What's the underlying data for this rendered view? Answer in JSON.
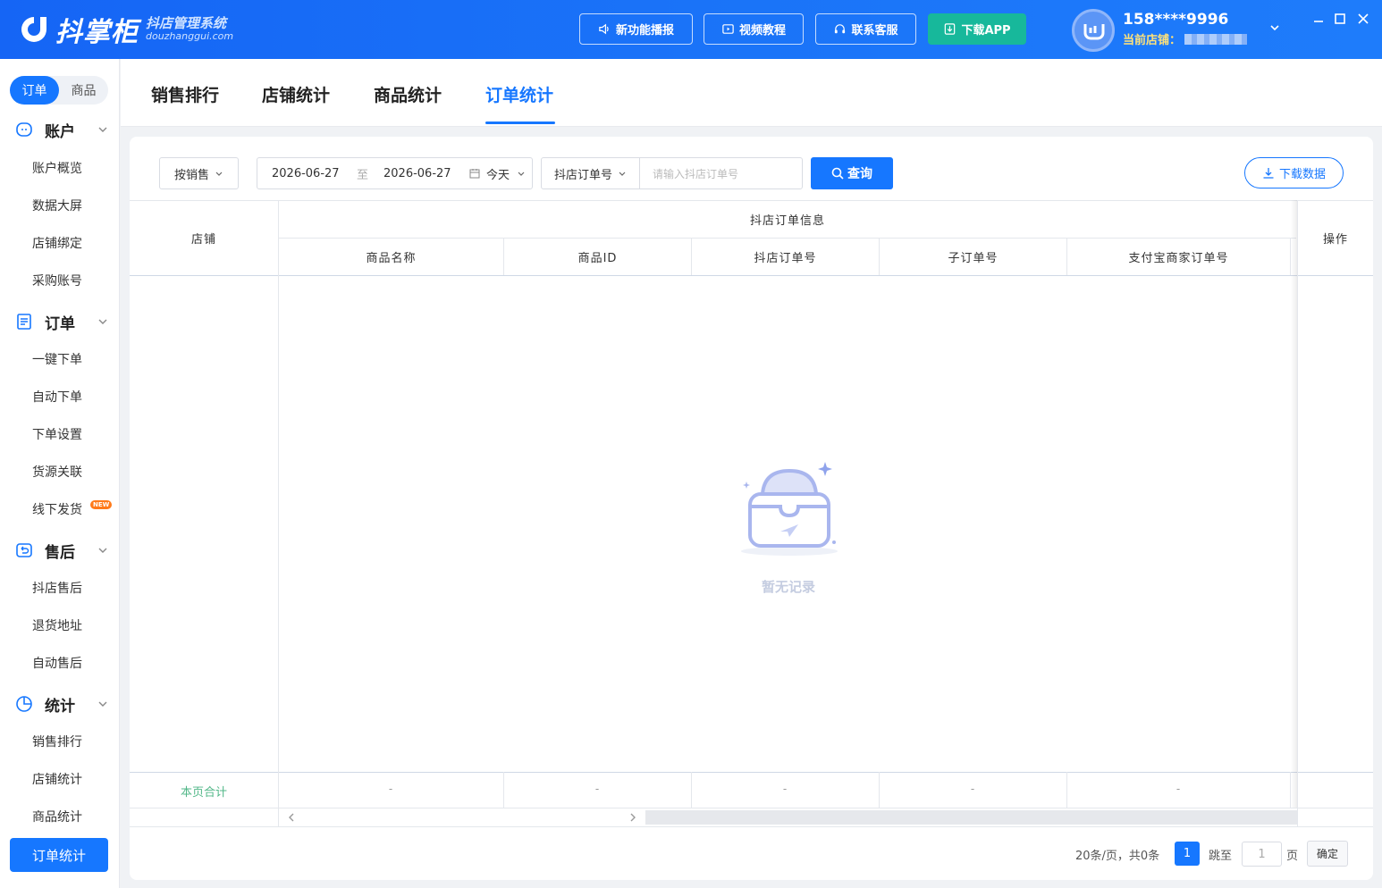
{
  "header": {
    "logo_name": "抖掌柜",
    "logo_tagline": "抖店管理系统",
    "logo_domain": "douzhanggui.com",
    "buttons": [
      {
        "label": "新功能播报",
        "icon": "speaker-icon"
      },
      {
        "label": "视频教程",
        "icon": "video-icon"
      },
      {
        "label": "联系客服",
        "icon": "headset-icon"
      },
      {
        "label": "下载APP",
        "icon": "download-icon"
      }
    ],
    "user_phone": "158****9996",
    "store_label": "当前店铺："
  },
  "sidebar": {
    "segments": [
      "订单",
      "商品"
    ],
    "groups": [
      {
        "label": "账户",
        "icon": "account-icon",
        "items": [
          "账户概览",
          "数据大屏",
          "店铺绑定",
          "采购账号"
        ]
      },
      {
        "label": "订单",
        "icon": "order-list-icon",
        "items": [
          "一键下单",
          "自动下单",
          "下单设置",
          "货源关联",
          "线下发货"
        ]
      },
      {
        "label": "售后",
        "icon": "after-sale-icon",
        "items": [
          "抖店售后",
          "退货地址",
          "自动售后"
        ]
      },
      {
        "label": "统计",
        "icon": "pie-chart-icon",
        "items": [
          "销售排行",
          "店铺统计",
          "商品统计",
          "订单统计"
        ]
      }
    ],
    "new_badge": "NEW",
    "active_item": "订单统计"
  },
  "tabs": [
    "销售排行",
    "店铺统计",
    "商品统计",
    "订单统计"
  ],
  "active_tab": "订单统计",
  "filters": {
    "mode": "按销售",
    "date_start": "2026-06-27",
    "date_sep": "至",
    "date_end": "2026-06-27",
    "date_shortcut": "今天",
    "search_type": "抖店订单号",
    "search_placeholder": "请输入抖店订单号",
    "query_label": "查询",
    "download_label": "下载数据"
  },
  "table": {
    "col_store": "店铺",
    "group_header": "抖店订单信息",
    "columns": [
      "商品名称",
      "商品ID",
      "抖店订单号",
      "子订单号",
      "支付宝商家订单号"
    ],
    "col_action": "操作",
    "empty_text": "暂无记录",
    "summary_label": "本页合计",
    "summary_values": [
      "-",
      "-",
      "-",
      "-",
      "-"
    ]
  },
  "pagination": {
    "page_size_info": "20条/页，共0条",
    "current_page": "1",
    "jump_label": "跳至",
    "jump_value": "1",
    "page_unit": "页",
    "confirm_label": "确定"
  },
  "colors": {
    "primary": "#1677ff",
    "header_bg": "#1a73f8",
    "download_app": "#17b89b",
    "summary_text": "#52b788"
  }
}
